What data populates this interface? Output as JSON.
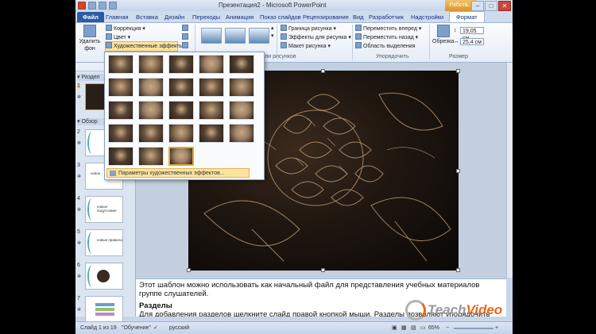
{
  "window": {
    "title": "Презентация2 - Microsoft PowerPoint",
    "context_tab": "Работа...",
    "controls": [
      "–",
      "□",
      "✕"
    ]
  },
  "tabs": [
    {
      "label": "Файл",
      "kind": "file"
    },
    {
      "label": "Главная"
    },
    {
      "label": "Вставка"
    },
    {
      "label": "Дизайн"
    },
    {
      "label": "Переходы"
    },
    {
      "label": "Анимация"
    },
    {
      "label": "Показ слайдов"
    },
    {
      "label": "Рецензирование"
    },
    {
      "label": "Вид"
    },
    {
      "label": "Разработчик"
    },
    {
      "label": "Надстройки"
    },
    {
      "label": "Формат",
      "kind": "active"
    }
  ],
  "ribbon": {
    "remove_bg": "Удалить фон",
    "correction": "Коррекция",
    "color": "Цвет",
    "artistic_effects": "Художественные эффекты",
    "picture_border": "Граница рисунка",
    "picture_effects": "Эффекты для рисунка",
    "picture_layout": "Макет рисунка",
    "bring_forward": "Переместить вперед",
    "send_backward": "Переместить назад",
    "selection_pane": "Область выделения",
    "crop": "Обрезка",
    "height": "19,05 см",
    "width": "25,4 см",
    "group_styles": "Стили рисунков",
    "group_arrange": "Упорядочить",
    "group_size": "Размер"
  },
  "left_panel": {
    "section1": "Раздел",
    "section2": "Обзор",
    "slides": [
      {
        "num": "1",
        "title": ""
      },
      {
        "num": "2",
        "title": ""
      },
      {
        "num": "3",
        "title": "новое"
      },
      {
        "num": "4",
        "title": "новые подусловие"
      },
      {
        "num": "5",
        "title": "новые правила"
      },
      {
        "num": "6",
        "title": ""
      },
      {
        "num": "7",
        "title": ""
      }
    ]
  },
  "gallery": {
    "option_label": "Параметры художественных эффектов...",
    "effect_count": 23,
    "selected_index": 22
  },
  "notes": {
    "line1": "Этот шаблон можно использовать как начальный файл для представления учебных материалов группе слушателей.",
    "heading": "Разделы",
    "line2": "Для добавления разделов щелкните слайд правой кнопкой мыши. Разделы позволяют упорядочить слайды и"
  },
  "statusbar": {
    "slide_info": "Слайд 1 из 19",
    "theme": "\"Обучение\"",
    "language": "русский",
    "zoom": "65%"
  },
  "watermark": {
    "brand_a": "Teach",
    "brand_b": "Video"
  }
}
